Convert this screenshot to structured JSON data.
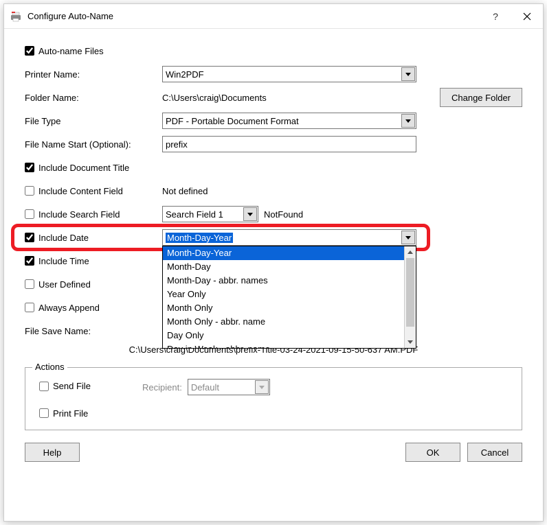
{
  "title": "Configure Auto-Name",
  "labels": {
    "autoNameFiles": "Auto-name Files",
    "printerName": "Printer Name:",
    "folderName": "Folder Name:",
    "changeFolder": "Change Folder",
    "fileType": "File Type",
    "fileNameStart": "File Name Start (Optional):",
    "includeDocTitle": "Include Document Title",
    "includeContentField": "Include Content Field",
    "includeSearchField": "Include Search Field",
    "includeDate": "Include Date",
    "includeTime": "Include Time",
    "userDefined": "User Defined",
    "alwaysAppend": "Always Append",
    "fileSaveName": "File Save Name:",
    "actions": "Actions",
    "sendFile": "Send File",
    "printFile": "Print File",
    "recipient": "Recipient:",
    "help": "Help",
    "ok": "OK",
    "cancel": "Cancel",
    "notDefined": "Not defined",
    "notFound": "NotFound"
  },
  "values": {
    "printerName": "Win2PDF",
    "folderPath": "C:\\Users\\craig\\Documents",
    "fileType": "PDF - Portable Document Format",
    "fileNameStart": "prefix",
    "searchField": "Search Field 1",
    "includeDateSelected": "Month-Day-Year",
    "recipient": "Default",
    "saveNamePreview": "C:\\Users\\craig\\Documents\\prefix-Title-03-24-2021-09-15-50-637 AM.PDF"
  },
  "checks": {
    "autoNameFiles": true,
    "includeDocTitle": true,
    "includeContentField": false,
    "includeSearchField": false,
    "includeDate": true,
    "includeTime": true,
    "userDefined": false,
    "alwaysAppend": false,
    "sendFile": false,
    "printFile": false
  },
  "dateOptions": [
    "Month-Day-Year",
    "Month-Day",
    "Month-Day - abbr. names",
    "Year Only",
    "Month Only",
    "Month Only - abbr. name",
    "Day Only",
    "Day in Week - abbr. name"
  ]
}
